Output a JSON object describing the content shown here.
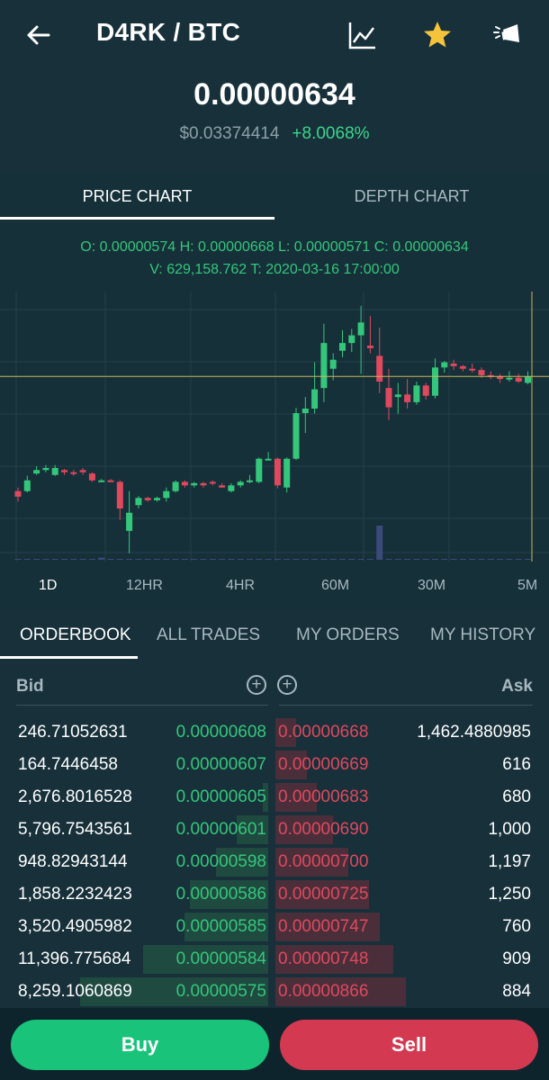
{
  "header": {
    "pair": "D4RK / BTC",
    "icons": [
      "back-arrow-icon",
      "line-chart-icon",
      "star-icon",
      "megaphone-icon"
    ],
    "star_color": "#f4c53b"
  },
  "ticker": {
    "price": "0.00000634",
    "usd_price": "$0.03374414",
    "change": "+8.0068%"
  },
  "chart_tabs": [
    "PRICE CHART",
    "DEPTH CHART"
  ],
  "ohlc": {
    "line1": "O:  0.00000574  H:  0.00000668  L:  0.00000571  C:  0.00000634",
    "line2": "V:  629,158.762  T:  2020-03-16 17:00:00"
  },
  "timeframes": [
    "1D",
    "12HR",
    "4HR",
    "60M",
    "30M",
    "5M"
  ],
  "orderbook_tabs": [
    "ORDERBOOK",
    "ALL TRADES",
    "MY ORDERS",
    "MY HISTORY"
  ],
  "orderbook": {
    "bid_label": "Bid",
    "ask_label": "Ask",
    "rows": [
      {
        "bid_qty": "246.71052631",
        "bid_price": "0.00000608",
        "ask_price": "0.00000668",
        "ask_qty": "1,462.4880985",
        "bid_depth": 0.0,
        "ask_depth": 0.08
      },
      {
        "bid_qty": "164.7446458",
        "bid_price": "0.00000607",
        "ask_price": "0.00000669",
        "ask_qty": "616",
        "bid_depth": 0.0,
        "ask_depth": 0.12
      },
      {
        "bid_qty": "2,676.8016528",
        "bid_price": "0.00000605",
        "ask_price": "0.00000683",
        "ask_qty": "680",
        "bid_depth": 0.02,
        "ask_depth": 0.16
      },
      {
        "bid_qty": "5,796.7543561",
        "bid_price": "0.00000601",
        "ask_price": "0.00000690",
        "ask_qty": "1,000",
        "bid_depth": 0.12,
        "ask_depth": 0.22
      },
      {
        "bid_qty": "948.82943144",
        "bid_price": "0.00000598",
        "ask_price": "0.00000700",
        "ask_qty": "1,197",
        "bid_depth": 0.2,
        "ask_depth": 0.28
      },
      {
        "bid_qty": "1,858.2232423",
        "bid_price": "0.00000586",
        "ask_price": "0.00000725",
        "ask_qty": "1,250",
        "bid_depth": 0.3,
        "ask_depth": 0.36
      },
      {
        "bid_qty": "3,520.4905982",
        "bid_price": "0.00000585",
        "ask_price": "0.00000747",
        "ask_qty": "760",
        "bid_depth": 0.32,
        "ask_depth": 0.4
      },
      {
        "bid_qty": "11,396.775684",
        "bid_price": "0.00000584",
        "ask_price": "0.00000748",
        "ask_qty": "909",
        "bid_depth": 0.48,
        "ask_depth": 0.45
      },
      {
        "bid_qty": "8,259.1060869",
        "bid_price": "0.00000575",
        "ask_price": "0.00000866",
        "ask_qty": "884",
        "bid_depth": 0.72,
        "ask_depth": 0.5
      }
    ]
  },
  "actions": {
    "buy": "Buy",
    "sell": "Sell"
  },
  "colors": {
    "up": "#34c77b",
    "down": "#e0485e",
    "background": "#17303a",
    "buy": "#19c37a",
    "sell": "#d33a52"
  },
  "chart_data": {
    "type": "candlestick",
    "current_price": 6.34e-06,
    "candles": [
      {
        "o": 5.448e-06,
        "h": 5.476e-06,
        "l": 5.366e-06,
        "c": 5.405e-06
      },
      {
        "o": 5.448e-06,
        "h": 5.568e-06,
        "l": 5.438e-06,
        "c": 5.532e-06
      },
      {
        "o": 5.585e-06,
        "h": 5.642e-06,
        "l": 5.574e-06,
        "c": 5.612e-06
      },
      {
        "o": 5.612e-06,
        "h": 5.651e-06,
        "l": 5.595e-06,
        "c": 5.628e-06
      },
      {
        "o": 5.574e-06,
        "h": 5.651e-06,
        "l": 5.567e-06,
        "c": 5.628e-06
      },
      {
        "o": 5.612e-06,
        "h": 5.62e-06,
        "l": 5.574e-06,
        "c": 5.595e-06
      },
      {
        "o": 5.595e-06,
        "h": 5.612e-06,
        "l": 5.567e-06,
        "c": 5.585e-06
      },
      {
        "o": 5.612e-06,
        "h": 5.628e-06,
        "l": 5.574e-06,
        "c": 5.595e-06
      },
      {
        "o": 5.585e-06,
        "h": 5.595e-06,
        "l": 5.52e-06,
        "c": 5.532e-06
      },
      {
        "o": 5.532e-06,
        "h": 5.542e-06,
        "l": 5.532e-06,
        "c": 5.532e-06
      },
      {
        "o": 5.532e-06,
        "h": 5.542e-06,
        "l": 5.52e-06,
        "c": 5.52e-06
      },
      {
        "o": 5.52e-06,
        "h": 5.532e-06,
        "l": 5.224e-06,
        "c": 5.313e-06
      },
      {
        "o": 5.139e-06,
        "h": 5.448e-06,
        "l": 4.964e-06,
        "c": 5.28e-06
      },
      {
        "o": 5.339e-06,
        "h": 5.41e-06,
        "l": 5.313e-06,
        "c": 5.395e-06
      },
      {
        "o": 5.395e-06,
        "h": 5.405e-06,
        "l": 5.366e-06,
        "c": 5.377e-06
      },
      {
        "o": 5.377e-06,
        "h": 5.405e-06,
        "l": 5.366e-06,
        "c": 5.395e-06
      },
      {
        "o": 5.395e-06,
        "h": 5.476e-06,
        "l": 5.366e-06,
        "c": 5.448e-06
      },
      {
        "o": 5.448e-06,
        "h": 5.532e-06,
        "l": 5.438e-06,
        "c": 5.52e-06
      },
      {
        "o": 5.52e-06,
        "h": 5.532e-06,
        "l": 5.476e-06,
        "c": 5.493e-06
      },
      {
        "o": 5.493e-06,
        "h": 5.52e-06,
        "l": 5.476e-06,
        "c": 5.51e-06
      },
      {
        "o": 5.51e-06,
        "h": 5.52e-06,
        "l": 5.476e-06,
        "c": 5.493e-06
      },
      {
        "o": 5.52e-06,
        "h": 5.532e-06,
        "l": 5.493e-06,
        "c": 5.51e-06
      },
      {
        "o": 5.493e-06,
        "h": 5.51e-06,
        "l": 5.476e-06,
        "c": 5.476e-06
      },
      {
        "o": 5.448e-06,
        "h": 5.51e-06,
        "l": 5.438e-06,
        "c": 5.493e-06
      },
      {
        "o": 5.493e-06,
        "h": 5.532e-06,
        "l": 5.476e-06,
        "c": 5.52e-06
      },
      {
        "o": 5.52e-06,
        "h": 5.574e-06,
        "l": 5.51e-06,
        "c": 5.532e-06
      },
      {
        "o": 5.52e-06,
        "h": 5.71e-06,
        "l": 5.51e-06,
        "c": 5.7e-06
      },
      {
        "o": 5.7e-06,
        "h": 5.753e-06,
        "l": 5.69e-06,
        "c": 5.7e-06
      },
      {
        "o": 5.7e-06,
        "h": 5.71e-06,
        "l": 5.47e-06,
        "c": 5.493e-06
      },
      {
        "o": 5.476e-06,
        "h": 5.71e-06,
        "l": 5.438e-06,
        "c": 5.7e-06
      },
      {
        "o": 5.7e-06,
        "h": 6.095e-06,
        "l": 5.69e-06,
        "c": 6.055e-06
      },
      {
        "o": 6.055e-06,
        "h": 6.18e-06,
        "l": 5.9e-06,
        "c": 6.09e-06
      },
      {
        "o": 6.09e-06,
        "h": 6.45e-06,
        "l": 6.05e-06,
        "c": 6.24e-06
      },
      {
        "o": 6.25e-06,
        "h": 6.75e-06,
        "l": 6.14e-06,
        "c": 6.6e-06
      },
      {
        "o": 6.4e-06,
        "h": 6.52e-06,
        "l": 6.31e-06,
        "c": 6.47e-06
      },
      {
        "o": 6.54e-06,
        "h": 6.7e-06,
        "l": 6.49e-06,
        "c": 6.6e-06
      },
      {
        "o": 6.6e-06,
        "h": 6.71e-06,
        "l": 6.53e-06,
        "c": 6.66e-06
      },
      {
        "o": 6.66e-06,
        "h": 6.89e-06,
        "l": 6.36e-06,
        "c": 6.76e-06
      },
      {
        "o": 6.58e-06,
        "h": 6.81e-06,
        "l": 6.52e-06,
        "c": 6.56e-06
      },
      {
        "o": 6.5e-06,
        "h": 6.72e-06,
        "l": 6.21e-06,
        "c": 6.3e-06
      },
      {
        "o": 6.25e-06,
        "h": 6.4e-06,
        "l": 6e-06,
        "c": 6.1e-06
      },
      {
        "o": 6.18e-06,
        "h": 6.29e-06,
        "l": 6.05e-06,
        "c": 6.2e-06
      },
      {
        "o": 6.2e-06,
        "h": 6.32e-06,
        "l": 6.09e-06,
        "c": 6.14e-06
      },
      {
        "o": 6.14e-06,
        "h": 6.3e-06,
        "l": 6.12e-06,
        "c": 6.27e-06
      },
      {
        "o": 6.27e-06,
        "h": 6.29e-06,
        "l": 6.16e-06,
        "c": 6.19e-06
      },
      {
        "o": 6.19e-06,
        "h": 6.48e-06,
        "l": 6.17e-06,
        "c": 6.41e-06
      },
      {
        "o": 6.41e-06,
        "h": 6.46e-06,
        "l": 6.37e-06,
        "c": 6.45e-06
      },
      {
        "o": 6.44e-06,
        "h": 6.47e-06,
        "l": 6.39e-06,
        "c": 6.42e-06
      },
      {
        "o": 6.42e-06,
        "h": 6.43e-06,
        "l": 6.38e-06,
        "c": 6.4e-06
      },
      {
        "o": 6.4e-06,
        "h": 6.44e-06,
        "l": 6.37e-06,
        "c": 6.39e-06
      },
      {
        "o": 6.39e-06,
        "h": 6.41e-06,
        "l": 6.33e-06,
        "c": 6.35e-06
      },
      {
        "o": 6.35e-06,
        "h": 6.38e-06,
        "l": 6.32e-06,
        "c": 6.34e-06
      },
      {
        "o": 6.34e-06,
        "h": 6.36e-06,
        "l": 6.29e-06,
        "c": 6.32e-06
      },
      {
        "o": 6.32e-06,
        "h": 6.38e-06,
        "l": 6.3e-06,
        "c": 6.33e-06
      },
      {
        "o": 6.33e-06,
        "h": 6.36e-06,
        "l": 6.29e-06,
        "c": 6.3e-06
      },
      {
        "o": 6.29e-06,
        "h": 6.38e-06,
        "l": 6.28e-06,
        "c": 6.34e-06
      }
    ],
    "volumes": [
      0,
      0,
      0,
      0,
      0,
      0,
      0,
      0,
      0.02,
      0.06,
      0.02,
      0,
      0,
      0,
      0,
      0,
      0,
      0,
      0,
      0,
      0.01,
      0.01,
      0.01,
      0.01,
      0.01,
      0.01,
      0.01,
      0.01,
      0.01,
      0.01,
      0.01,
      0.01,
      0.01,
      0.01,
      0.01,
      0.01,
      0.01,
      0.01,
      0.01,
      0.01,
      0.01,
      0.01,
      0.01,
      0.01,
      0.01,
      0.01,
      0.01,
      0.01,
      0.01,
      0.01,
      0.01,
      0.01,
      0.01,
      0.01,
      0.01,
      0.01
    ],
    "volume_spike_index": 39,
    "volume_spike_value": 0.95
  }
}
